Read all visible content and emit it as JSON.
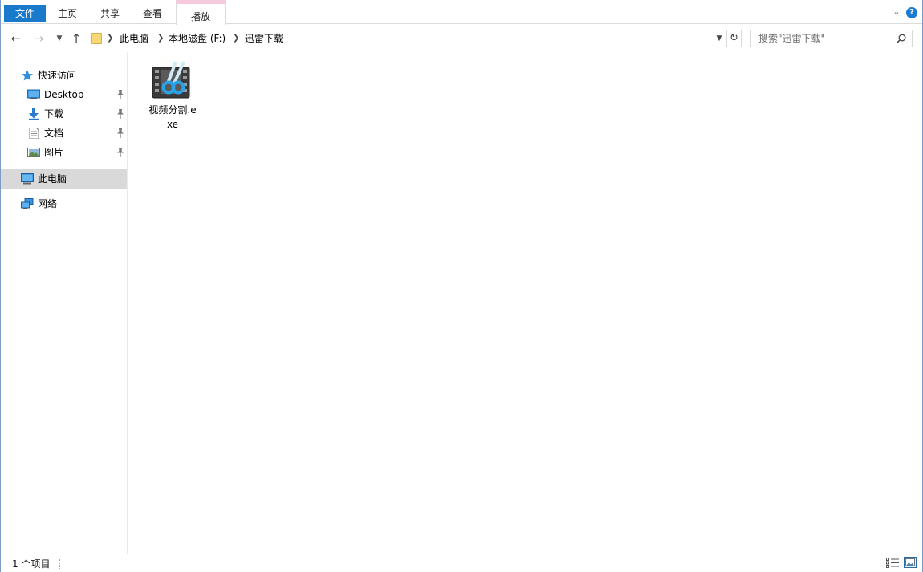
{
  "ribbon": {
    "tabs": {
      "file": "文件",
      "home": "主页",
      "share": "共享",
      "view": "查看",
      "play": "播放"
    },
    "accent_color": "#1979ca",
    "context_tab_color": "#f6c9dc"
  },
  "address": {
    "crumbs": [
      "此电脑",
      "本地磁盘 (F:)",
      "迅雷下载"
    ]
  },
  "search": {
    "placeholder": "搜索\"迅雷下载\""
  },
  "nav": {
    "quick_access": "快速访问",
    "items": [
      {
        "label": "Desktop",
        "icon": "desktop-icon",
        "pinned": true
      },
      {
        "label": "下载",
        "icon": "download-icon",
        "pinned": true
      },
      {
        "label": "文档",
        "icon": "document-icon",
        "pinned": true
      },
      {
        "label": "图片",
        "icon": "picture-icon",
        "pinned": true
      }
    ],
    "this_pc": "此电脑",
    "network": "网络"
  },
  "files": [
    {
      "name": "视频分割.exe",
      "icon": "video-cutter-icon"
    }
  ],
  "status": {
    "count_text": "1 个项目"
  }
}
